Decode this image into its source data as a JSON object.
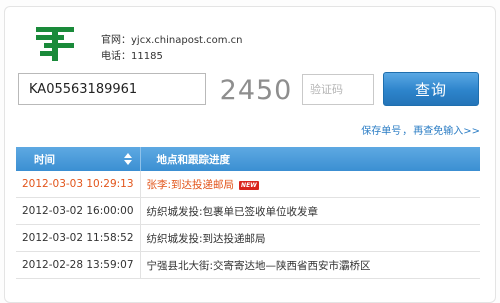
{
  "header": {
    "website_label": "官网：",
    "website_url": "yjcx.chinapost.com.cn",
    "phone_label": "电话：",
    "phone_number": "11185"
  },
  "search": {
    "tracking_number": "KA05563189961",
    "captcha_code": "2450",
    "captcha_placeholder": "验证码",
    "query_label": "查询"
  },
  "links": {
    "save_number": "保存单号",
    "separator": "，",
    "no_input_next": "再查免输入>>"
  },
  "table": {
    "headers": {
      "time": "时间",
      "location": "地点和跟踪进度"
    },
    "new_badge": "NEW",
    "rows": [
      {
        "time": "2012-03-03 10:29:13",
        "event": "张李:到达投递邮局",
        "is_new": true
      },
      {
        "time": "2012-03-02 16:00:00",
        "event": "纺织城发投:包裹单已签收单位收发章",
        "is_new": false
      },
      {
        "time": "2012-03-02 11:58:52",
        "event": "纺织城发投:到达投递邮局",
        "is_new": false
      },
      {
        "time": "2012-02-28 13:59:07",
        "event": "宁强县北大街:交寄寄达地—陕西省西安市灞桥区",
        "is_new": false
      }
    ]
  },
  "colors": {
    "brand_green": "#1a8a3a",
    "header_blue": "#4a9ad8",
    "button_blue": "#2d84cb",
    "link_blue": "#2a7cc4",
    "latest_orange": "#e2551b",
    "badge_red": "#d9241c"
  },
  "icons": {
    "logo": "china-post-logo",
    "sort": "sort-arrows-icon"
  }
}
